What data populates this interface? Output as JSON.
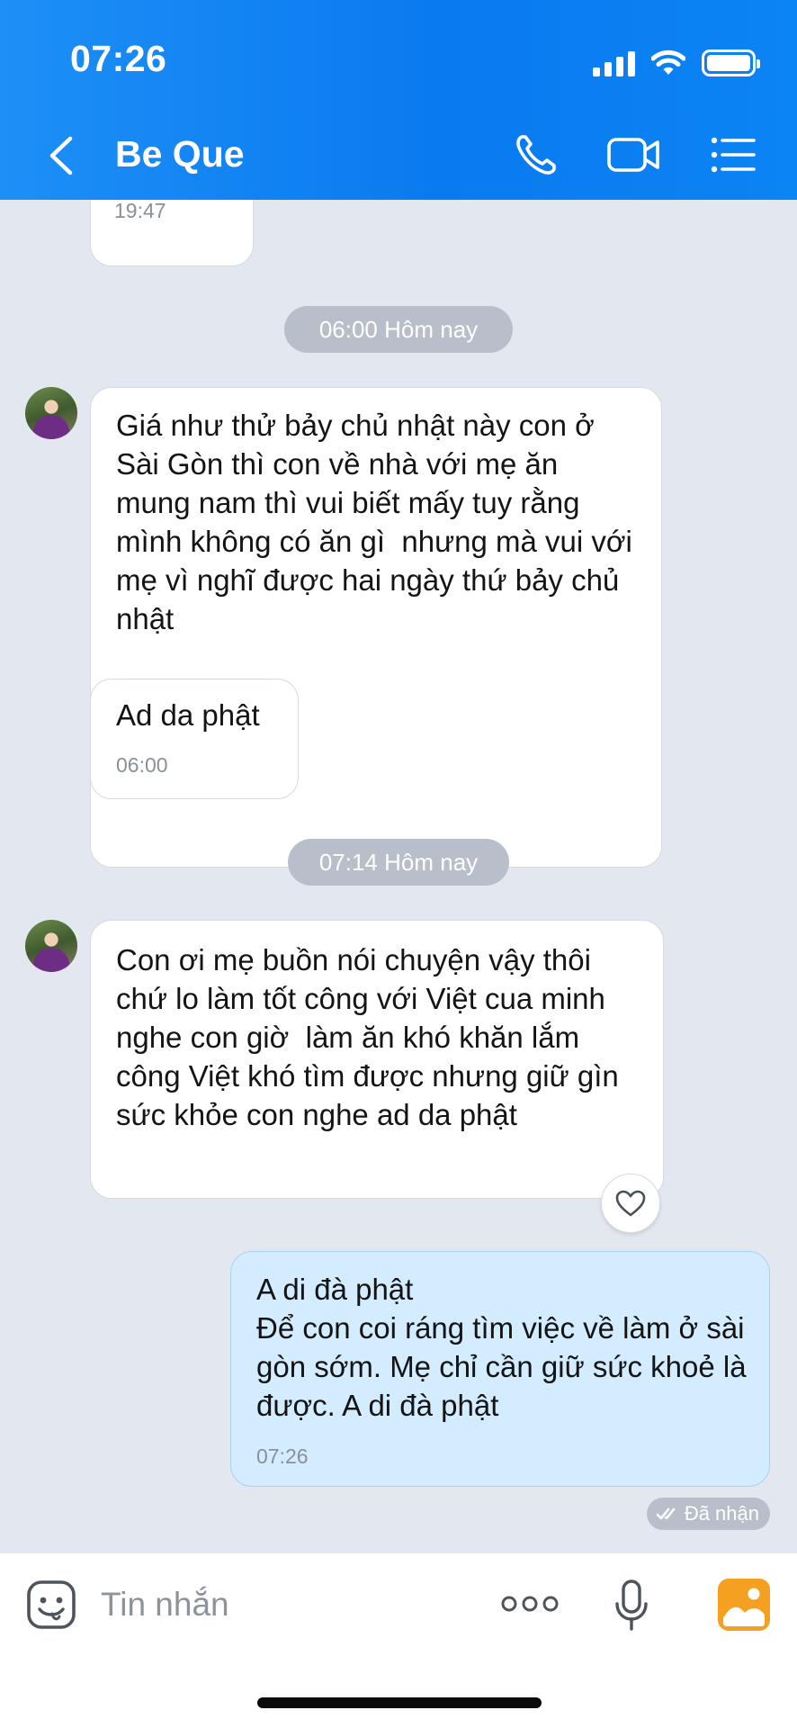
{
  "status_bar": {
    "time": "07:26"
  },
  "header": {
    "contact_name": "Be Que",
    "icons": [
      "back-chevron-icon",
      "phone-icon",
      "video-call-icon",
      "list-menu-icon"
    ]
  },
  "messages": {
    "prev_time": "19:47",
    "stamp1": "06:00 Hôm nay",
    "msg1_text": "Giá như thử bảy chủ nhật này con ở Sài Gòn thì con về nhà với mẹ ăn mung nam thì vui biết mấy tuy rằng mình không có ăn gì  nhưng mà vui với mẹ vì nghĩ được hai ngày thứ bảy chủ nhật",
    "msg2_text": "Ad da phật",
    "msg2_time": "06:00",
    "stamp2": "07:14 Hôm nay",
    "msg3_text": "Con ơi mẹ buồn nói chuyện vậy thôi chứ lo làm tốt công với Việt cua minh nghe con giờ  làm ăn khó khăn lắm công Việt khó tìm được nhưng giữ gìn sức khỏe con nghe ad da phật",
    "msg4_text": "A di đà phật\nĐể con coi ráng tìm việc về làm ở sài gòn sớm. Mẹ chỉ cần giữ sức khoẻ là được. A di đà phật",
    "msg4_time": "07:26",
    "received_label": "Đã nhận"
  },
  "input_bar": {
    "placeholder": "Tin nhắn",
    "icons": [
      "sticker-icon",
      "more-options-icon",
      "microphone-icon",
      "image-gallery-icon"
    ]
  },
  "colors": {
    "header_blue": "#0a7af0",
    "chat_background": "#e3e8f0",
    "sent_bubble": "#d3ecff",
    "stamp_grey": "#b8bfca",
    "gallery_orange": "#f5a021"
  }
}
